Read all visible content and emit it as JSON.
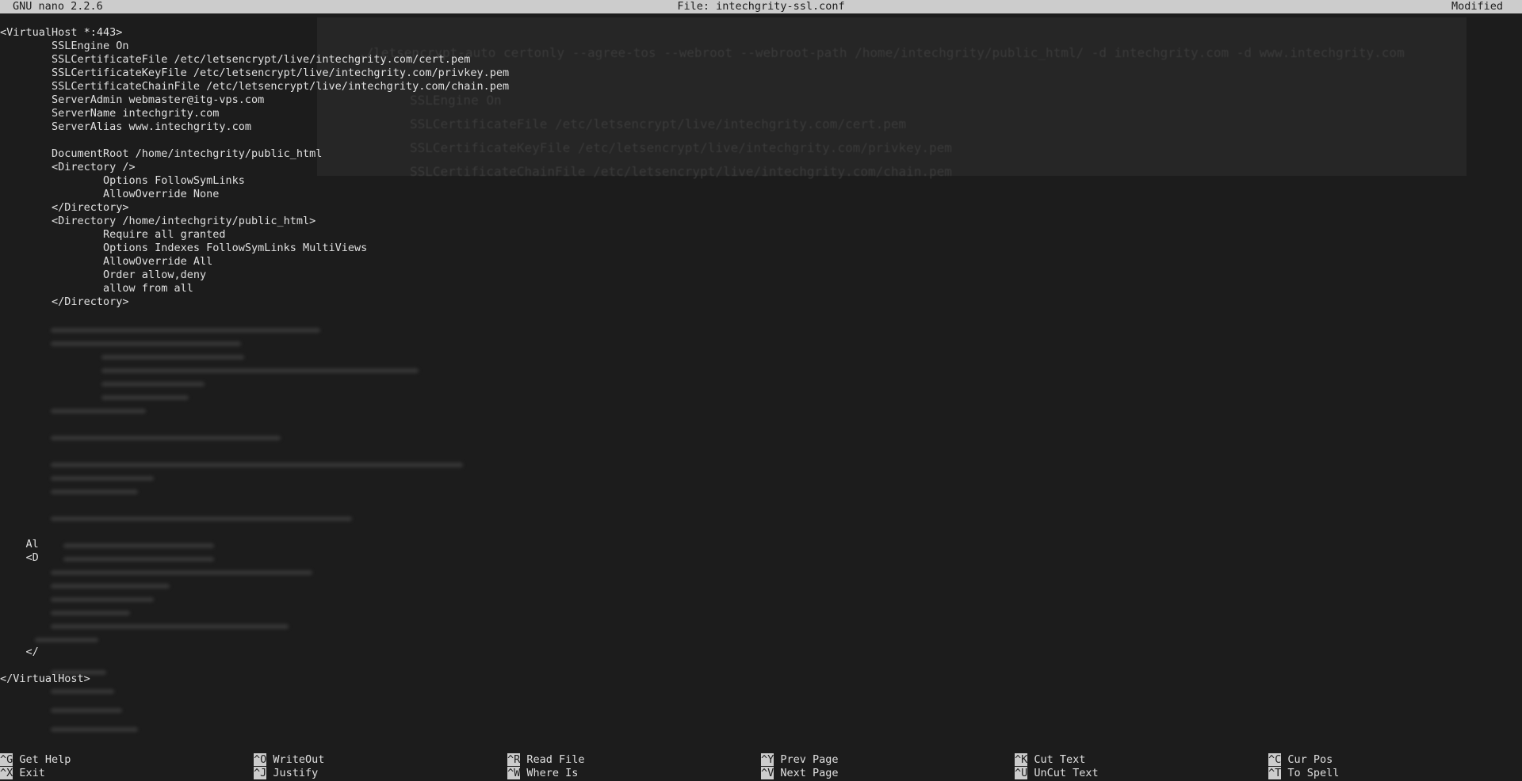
{
  "titlebar": {
    "app": "GNU nano 2.2.6",
    "file": "File: intechgrity-ssl.conf",
    "status": "Modified"
  },
  "editor": {
    "lines": [
      "<VirtualHost *:443>",
      "        SSLEngine On",
      "        SSLCertificateFile /etc/letsencrypt/live/intechgrity.com/cert.pem",
      "        SSLCertificateKeyFile /etc/letsencrypt/live/intechgrity.com/privkey.pem",
      "        SSLCertificateChainFile /etc/letsencrypt/live/intechgrity.com/chain.pem",
      "        ServerAdmin webmaster@itg-vps.com",
      "        ServerName intechgrity.com",
      "        ServerAlias www.intechgrity.com",
      "",
      "        DocumentRoot /home/intechgrity/public_html",
      "        <Directory />",
      "                Options FollowSymLinks",
      "                AllowOverride None",
      "        </Directory>",
      "        <Directory /home/intechgrity/public_html>",
      "                Require all granted",
      "                Options Indexes FollowSymLinks MultiViews",
      "                AllowOverride All",
      "                Order allow,deny",
      "                allow from all",
      "        </Directory>",
      "",
      "",
      "",
      "",
      "",
      "",
      "",
      "",
      "",
      "",
      "",
      "",
      "",
      "",
      "",
      "",
      "",
      "    Al",
      "    <D",
      "",
      "",
      "",
      "",
      "",
      "",
      "    </",
      "",
      "</VirtualHost>"
    ]
  },
  "ghost": {
    "command": "./letsencrypt-auto certonly --agree-tos --webroot --webroot-path /home/intechgrity/public_html/ -d intechgrity.com -d www.intechgrity.com",
    "sslengine": "SSLEngine On",
    "cert": "SSLCertificateFile /etc/letsencrypt/live/intechgrity.com/cert.pem",
    "key": "SSLCertificateKeyFile /etc/letsencrypt/live/intechgrity.com/privkey.pem",
    "chain": "SSLCertificateChainFile /etc/letsencrypt/live/intechgrity.com/chain.pem"
  },
  "shortcuts": [
    {
      "key": "^G",
      "label": "Get Help"
    },
    {
      "key": "^X",
      "label": "Exit"
    },
    {
      "key": "^O",
      "label": "WriteOut"
    },
    {
      "key": "^J",
      "label": "Justify"
    },
    {
      "key": "^R",
      "label": "Read File"
    },
    {
      "key": "^W",
      "label": "Where Is"
    },
    {
      "key": "^Y",
      "label": "Prev Page"
    },
    {
      "key": "^V",
      "label": "Next Page"
    },
    {
      "key": "^K",
      "label": "Cut Text"
    },
    {
      "key": "^U",
      "label": "UnCut Text"
    },
    {
      "key": "^C",
      "label": "Cur Pos"
    },
    {
      "key": "^T",
      "label": "To Spell"
    }
  ]
}
